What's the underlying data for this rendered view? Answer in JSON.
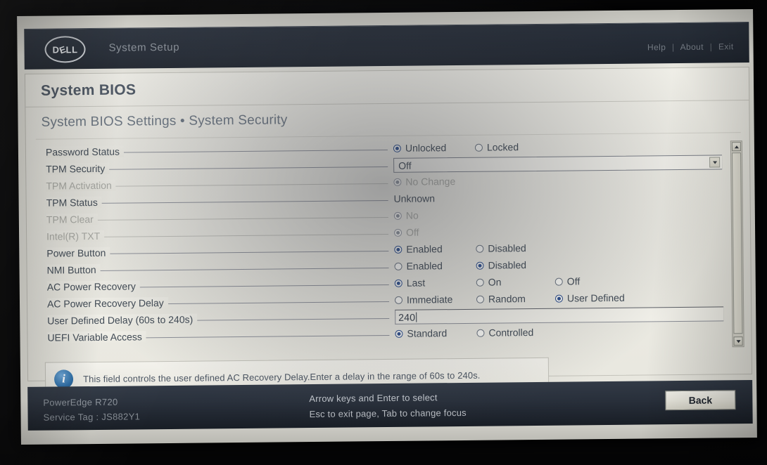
{
  "header": {
    "brand": "DELL",
    "setup_title": "System Setup",
    "nav": [
      {
        "label": "Help"
      },
      {
        "label": "About"
      },
      {
        "label": "Exit"
      }
    ],
    "nav_separator": "|"
  },
  "panel": {
    "title": "System BIOS",
    "section": "System BIOS Settings • System Security"
  },
  "settings": [
    {
      "label": "Password Status",
      "disabled": false,
      "type": "radio",
      "options": [
        {
          "label": "Unlocked",
          "selected": true,
          "col": 0
        },
        {
          "label": "Locked",
          "selected": false,
          "col": 1
        }
      ]
    },
    {
      "label": "TPM Security",
      "disabled": false,
      "type": "dropdown",
      "value": "Off"
    },
    {
      "label": "TPM Activation",
      "disabled": true,
      "type": "radio",
      "options": [
        {
          "label": "No Change",
          "selected": true,
          "col": 0
        }
      ]
    },
    {
      "label": "TPM Status",
      "disabled": false,
      "type": "text",
      "value": "Unknown"
    },
    {
      "label": "TPM Clear",
      "disabled": true,
      "type": "radio",
      "options": [
        {
          "label": "No",
          "selected": true,
          "col": 0
        }
      ]
    },
    {
      "label": "Intel(R) TXT",
      "disabled": true,
      "type": "radio",
      "options": [
        {
          "label": "Off",
          "selected": true,
          "col": 0
        }
      ]
    },
    {
      "label": "Power Button",
      "disabled": false,
      "type": "radio",
      "options": [
        {
          "label": "Enabled",
          "selected": true,
          "col": 0
        },
        {
          "label": "Disabled",
          "selected": false,
          "col": 1
        }
      ]
    },
    {
      "label": "NMI Button",
      "disabled": false,
      "type": "radio",
      "options": [
        {
          "label": "Enabled",
          "selected": false,
          "col": 0
        },
        {
          "label": "Disabled",
          "selected": true,
          "col": 1
        }
      ]
    },
    {
      "label": "AC Power Recovery",
      "disabled": false,
      "type": "radio",
      "options": [
        {
          "label": "Last",
          "selected": true,
          "col": 0
        },
        {
          "label": "On",
          "selected": false,
          "col": 1
        },
        {
          "label": "Off",
          "selected": false,
          "col": 2
        }
      ]
    },
    {
      "label": "AC Power Recovery Delay",
      "disabled": false,
      "type": "radio",
      "options": [
        {
          "label": "Immediate",
          "selected": false,
          "col": 0
        },
        {
          "label": "Random",
          "selected": false,
          "col": 1
        },
        {
          "label": "User Defined",
          "selected": true,
          "col": 2
        }
      ]
    },
    {
      "label": "User Defined Delay (60s to 240s)",
      "disabled": false,
      "type": "input",
      "value": "240"
    },
    {
      "label": "UEFI Variable Access",
      "disabled": false,
      "type": "radio",
      "options": [
        {
          "label": "Standard",
          "selected": true,
          "col": 0
        },
        {
          "label": "Controlled",
          "selected": false,
          "col": 1
        }
      ]
    }
  ],
  "help": {
    "icon": "info-icon",
    "icon_glyph": "i",
    "text": "This field controls the user defined AC Recovery Delay.Enter a delay in the range of 60s to 240s."
  },
  "footer": {
    "model": "PowerEdge R720",
    "service_tag": "Service Tag : JS882Y1",
    "hint_line1": "Arrow keys and Enter to select",
    "hint_line2": "Esc to exit page, Tab to change focus",
    "back_label": "Back"
  },
  "colors": {
    "header_bg": "#262d38",
    "panel_bg": "#eceade",
    "accent_blue": "#2d4f8e",
    "title_text": "#4c5663",
    "disabled_text": "#a9aaa4",
    "info_blue": "#2e6fa8"
  }
}
